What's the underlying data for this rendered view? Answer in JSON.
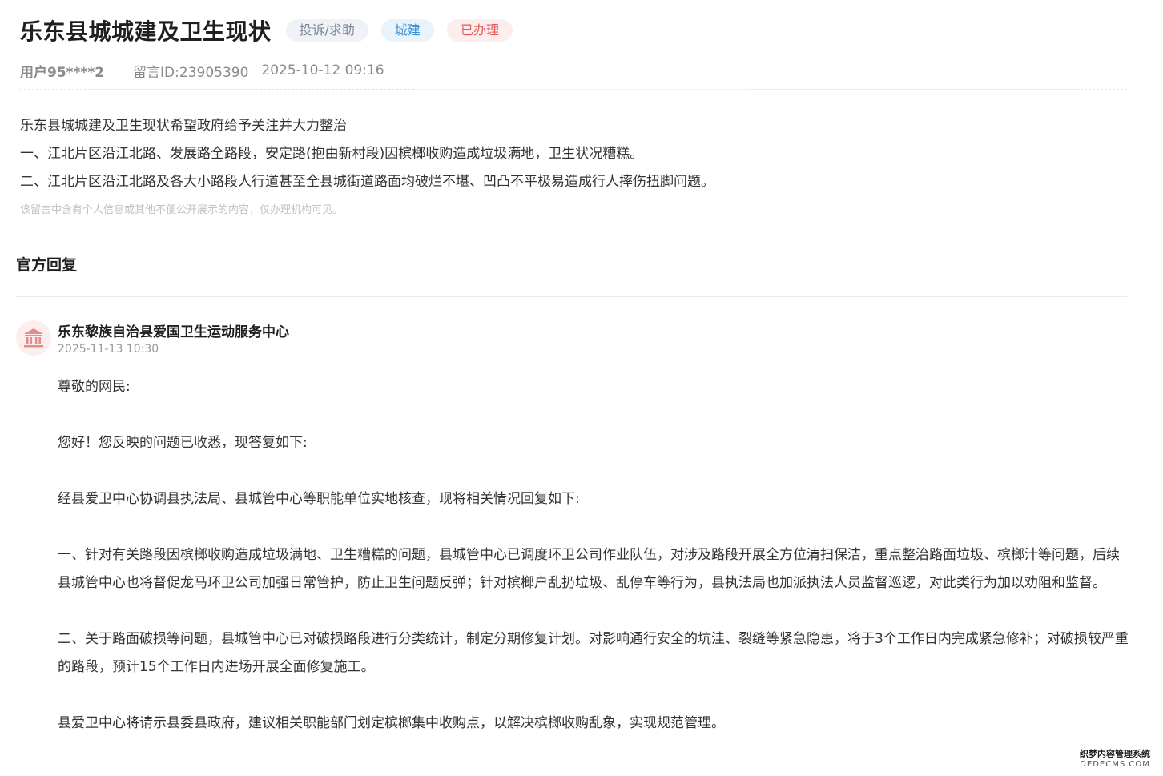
{
  "header": {
    "title": "乐东县城城建及卫生现状",
    "tags": {
      "type": "投诉/求助",
      "category": "城建",
      "status": "已办理"
    },
    "meta": {
      "user": "用户95****2",
      "message_id": "留言ID:23905390",
      "datetime": "2025-10-12 09:16"
    }
  },
  "message": {
    "lines": [
      "乐东县城城建及卫生现状希望政府给予关注并大力整治",
      "一、江北片区沿江北路、发展路全路段，安定路(抱由新村段)因槟榔收购造成垃圾满地，卫生状况糟糕。",
      "二、江北片区沿江北路及各大小路段人行道甚至全县城街道路面均破烂不堪、凹凸不平极易造成行人摔伤扭脚问题。"
    ],
    "privacy_note": "该留言中含有个人信息或其他不便公开展示的内容，仅办理机构可见。"
  },
  "reply_section": {
    "title": "官方回复",
    "org": {
      "icon": "government-building-icon",
      "name": "乐东黎族自治县爱国卫生运动服务中心",
      "datetime": "2025-11-13 10:30"
    },
    "paragraphs": [
      "尊敬的网民:",
      "您好！您反映的问题已收悉，现答复如下:",
      "经县爱卫中心协调县执法局、县城管中心等职能单位实地核查，现将相关情况回复如下:",
      "一、针对有关路段因槟榔收购造成垃圾满地、卫生糟糕的问题，县城管中心已调度环卫公司作业队伍，对涉及路段开展全方位清扫保洁，重点整治路面垃圾、槟榔汁等问题，后续县城管中心也将督促龙马环卫公司加强日常管护，防止卫生问题反弹；针对槟榔户乱扔垃圾、乱停车等行为，县执法局也加派执法人员监督巡逻，对此类行为加以劝阻和监督。",
      "二、关于路面破损等问题，县城管中心已对破损路段进行分类统计，制定分期修复计划。对影响通行安全的坑洼、裂缝等紧急隐患，将于3个工作日内完成紧急修补；对破损较严重的路段，预计15个工作日内进场开展全面修复施工。",
      "县爱卫中心将请示县委县政府，建议相关职能部门划定槟榔集中收购点，以解决槟榔收购乱象，实现规范管理。"
    ]
  },
  "watermark": {
    "top": "织梦内容管理系统",
    "bottom": "DEDECMS.COM"
  },
  "colors": {
    "avatar_bg": "#fdeeee",
    "avatar_icon": "#e88a8a",
    "tag_status": "#e05a5a",
    "tag_category": "#3d8fce"
  }
}
